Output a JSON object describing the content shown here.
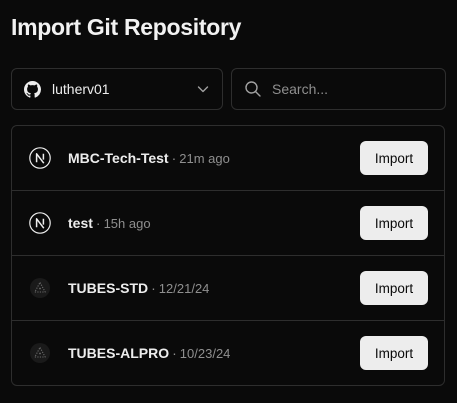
{
  "header": {
    "title": "Import Git Repository"
  },
  "account": {
    "icon": "github-icon",
    "name": "lutherv01",
    "chevron_icon": "chevron-down-icon"
  },
  "search": {
    "icon": "search-icon",
    "placeholder": "Search...",
    "value": ""
  },
  "repos": [
    {
      "icon": "nextjs-icon",
      "name": "MBC-Tech-Test",
      "separator": "·",
      "time": "21m ago",
      "button_label": "Import"
    },
    {
      "icon": "nextjs-icon",
      "name": "test",
      "separator": "·",
      "time": "15h ago",
      "button_label": "Import"
    },
    {
      "icon": "triangle-icon",
      "name": "TUBES-STD",
      "separator": "·",
      "time": "12/21/24",
      "button_label": "Import"
    },
    {
      "icon": "triangle-icon",
      "name": "TUBES-ALPRO",
      "separator": "·",
      "time": "10/23/24",
      "button_label": "Import"
    }
  ],
  "colors": {
    "background": "#0a0a0a",
    "border": "#2e2e2e",
    "text": "#ededed",
    "muted": "#8f8f8f",
    "button_bg": "#ededed",
    "button_text": "#0a0a0a"
  }
}
